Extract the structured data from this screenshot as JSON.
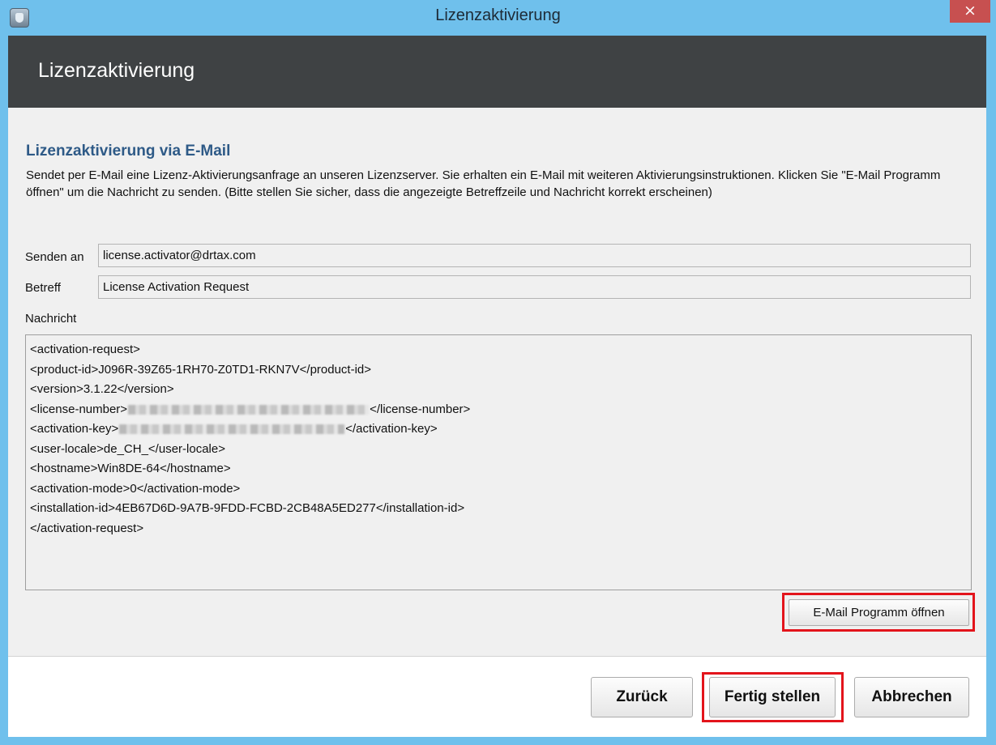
{
  "window": {
    "title": "Lizenzaktivierung",
    "close_glyph": "×",
    "app_icon": "app-icon"
  },
  "banner": {
    "title": "Lizenzaktivierung"
  },
  "section": {
    "title": "Lizenzaktivierung via E-Mail",
    "description": "Sendet per E-Mail eine Lizenz-Aktivierungsanfrage an unseren Lizenzserver. Sie erhalten ein E-Mail mit weiteren Aktivierungsinstruktionen. Klicken Sie \"E-Mail Programm öffnen\" um die Nachricht zu senden. (Bitte stellen Sie sicher, dass die angezeigte Betreffzeile und Nachricht korrekt erscheinen)"
  },
  "form": {
    "send_to_label": "Senden an",
    "send_to_value": "license.activator@drtax.com",
    "subject_label": "Betreff",
    "subject_value": "License Activation Request",
    "message_label": "Nachricht"
  },
  "message": {
    "line1": "<activation-request>",
    "line2": "<product-id>J096R-39Z65-1RH70-Z0TD1-RKN7V</product-id>",
    "line3": "<version>3.1.22</version>",
    "line4_open": "<license-number>",
    "line4_close": "</license-number>",
    "line5_open": "<activation-key>",
    "line5_close": "</activation-key>",
    "line6": "<user-locale>de_CH_</user-locale>",
    "line7": "<hostname>Win8DE-64</hostname>",
    "line8": "<activation-mode>0</activation-mode>",
    "line9": "<installation-id>4EB67D6D-9A7B-9FDD-FCBD-2CB48A5ED277</installation-id>",
    "line10": "</activation-request>"
  },
  "buttons": {
    "open_email": "E-Mail Programm öffnen",
    "back": "Zurück",
    "finish": "Fertig stellen",
    "cancel": "Abbrechen"
  },
  "colors": {
    "title_bar": "#6fc0ec",
    "banner": "#3f4244",
    "section_title": "#2e5a87",
    "highlight": "#e3141b",
    "close_button": "#c75050"
  }
}
